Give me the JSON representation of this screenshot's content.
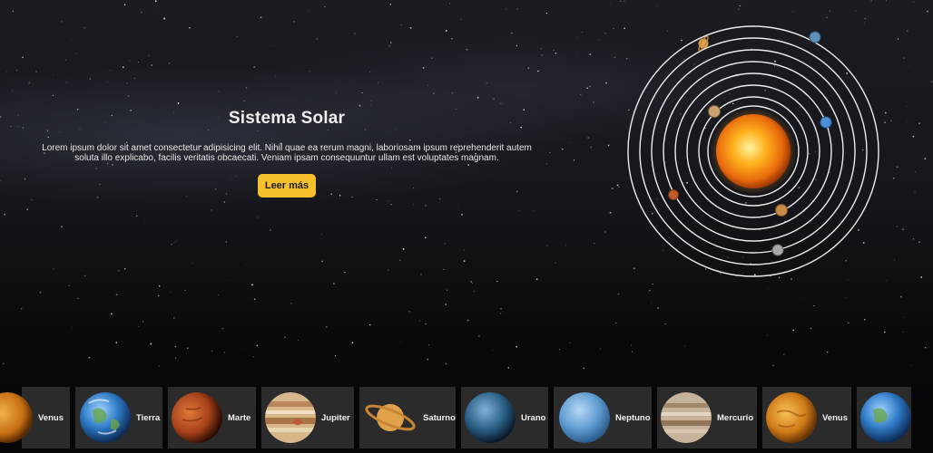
{
  "hero": {
    "title": "Sistema Solar",
    "text": "Lorem ipsum dolor sit amet consectetur adipisicing elit. Nihil quae ea rerum magni, laboriosam ipsum reprehenderit autem soluta illo explicabo, facilis veritatis obcaecati. Veniam ipsam consequuntur ullam est voluptates magnam.",
    "button_label": "Leer más"
  },
  "carousel": {
    "cards": [
      {
        "label": "Venus"
      },
      {
        "label": "Tierra"
      },
      {
        "label": "Marte"
      },
      {
        "label": "Jupiter"
      },
      {
        "label": "Saturno"
      },
      {
        "label": "Urano"
      },
      {
        "label": "Neptuno"
      },
      {
        "label": "Mercurio"
      },
      {
        "label": "Venus"
      },
      {
        "label": ""
      }
    ]
  },
  "colors": {
    "accent": "#f6bf2c",
    "card_bg": "#2b2b2c",
    "orbit": "#ffffff"
  }
}
